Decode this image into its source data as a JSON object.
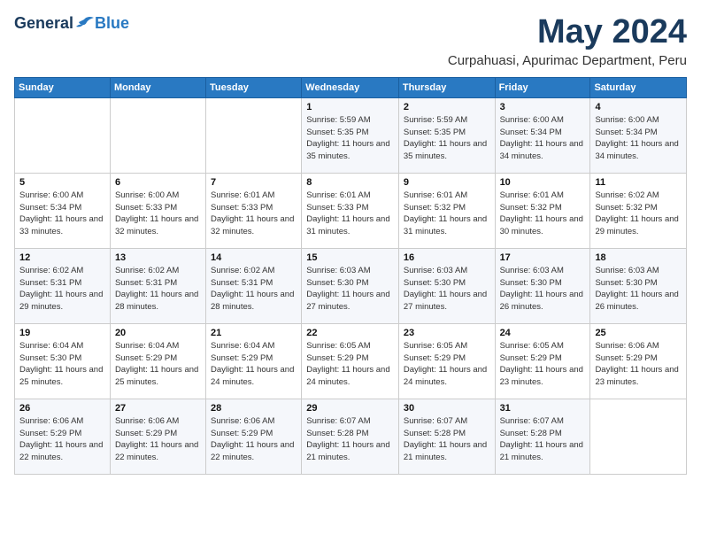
{
  "header": {
    "logo_general": "General",
    "logo_blue": "Blue",
    "month": "May 2024",
    "location": "Curpahuasi, Apurimac Department, Peru"
  },
  "weekdays": [
    "Sunday",
    "Monday",
    "Tuesday",
    "Wednesday",
    "Thursday",
    "Friday",
    "Saturday"
  ],
  "weeks": [
    [
      {
        "day": "",
        "sunrise": "",
        "sunset": "",
        "daylight": ""
      },
      {
        "day": "",
        "sunrise": "",
        "sunset": "",
        "daylight": ""
      },
      {
        "day": "",
        "sunrise": "",
        "sunset": "",
        "daylight": ""
      },
      {
        "day": "1",
        "sunrise": "Sunrise: 5:59 AM",
        "sunset": "Sunset: 5:35 PM",
        "daylight": "Daylight: 11 hours and 35 minutes."
      },
      {
        "day": "2",
        "sunrise": "Sunrise: 5:59 AM",
        "sunset": "Sunset: 5:35 PM",
        "daylight": "Daylight: 11 hours and 35 minutes."
      },
      {
        "day": "3",
        "sunrise": "Sunrise: 6:00 AM",
        "sunset": "Sunset: 5:34 PM",
        "daylight": "Daylight: 11 hours and 34 minutes."
      },
      {
        "day": "4",
        "sunrise": "Sunrise: 6:00 AM",
        "sunset": "Sunset: 5:34 PM",
        "daylight": "Daylight: 11 hours and 34 minutes."
      }
    ],
    [
      {
        "day": "5",
        "sunrise": "Sunrise: 6:00 AM",
        "sunset": "Sunset: 5:34 PM",
        "daylight": "Daylight: 11 hours and 33 minutes."
      },
      {
        "day": "6",
        "sunrise": "Sunrise: 6:00 AM",
        "sunset": "Sunset: 5:33 PM",
        "daylight": "Daylight: 11 hours and 32 minutes."
      },
      {
        "day": "7",
        "sunrise": "Sunrise: 6:01 AM",
        "sunset": "Sunset: 5:33 PM",
        "daylight": "Daylight: 11 hours and 32 minutes."
      },
      {
        "day": "8",
        "sunrise": "Sunrise: 6:01 AM",
        "sunset": "Sunset: 5:33 PM",
        "daylight": "Daylight: 11 hours and 31 minutes."
      },
      {
        "day": "9",
        "sunrise": "Sunrise: 6:01 AM",
        "sunset": "Sunset: 5:32 PM",
        "daylight": "Daylight: 11 hours and 31 minutes."
      },
      {
        "day": "10",
        "sunrise": "Sunrise: 6:01 AM",
        "sunset": "Sunset: 5:32 PM",
        "daylight": "Daylight: 11 hours and 30 minutes."
      },
      {
        "day": "11",
        "sunrise": "Sunrise: 6:02 AM",
        "sunset": "Sunset: 5:32 PM",
        "daylight": "Daylight: 11 hours and 29 minutes."
      }
    ],
    [
      {
        "day": "12",
        "sunrise": "Sunrise: 6:02 AM",
        "sunset": "Sunset: 5:31 PM",
        "daylight": "Daylight: 11 hours and 29 minutes."
      },
      {
        "day": "13",
        "sunrise": "Sunrise: 6:02 AM",
        "sunset": "Sunset: 5:31 PM",
        "daylight": "Daylight: 11 hours and 28 minutes."
      },
      {
        "day": "14",
        "sunrise": "Sunrise: 6:02 AM",
        "sunset": "Sunset: 5:31 PM",
        "daylight": "Daylight: 11 hours and 28 minutes."
      },
      {
        "day": "15",
        "sunrise": "Sunrise: 6:03 AM",
        "sunset": "Sunset: 5:30 PM",
        "daylight": "Daylight: 11 hours and 27 minutes."
      },
      {
        "day": "16",
        "sunrise": "Sunrise: 6:03 AM",
        "sunset": "Sunset: 5:30 PM",
        "daylight": "Daylight: 11 hours and 27 minutes."
      },
      {
        "day": "17",
        "sunrise": "Sunrise: 6:03 AM",
        "sunset": "Sunset: 5:30 PM",
        "daylight": "Daylight: 11 hours and 26 minutes."
      },
      {
        "day": "18",
        "sunrise": "Sunrise: 6:03 AM",
        "sunset": "Sunset: 5:30 PM",
        "daylight": "Daylight: 11 hours and 26 minutes."
      }
    ],
    [
      {
        "day": "19",
        "sunrise": "Sunrise: 6:04 AM",
        "sunset": "Sunset: 5:30 PM",
        "daylight": "Daylight: 11 hours and 25 minutes."
      },
      {
        "day": "20",
        "sunrise": "Sunrise: 6:04 AM",
        "sunset": "Sunset: 5:29 PM",
        "daylight": "Daylight: 11 hours and 25 minutes."
      },
      {
        "day": "21",
        "sunrise": "Sunrise: 6:04 AM",
        "sunset": "Sunset: 5:29 PM",
        "daylight": "Daylight: 11 hours and 24 minutes."
      },
      {
        "day": "22",
        "sunrise": "Sunrise: 6:05 AM",
        "sunset": "Sunset: 5:29 PM",
        "daylight": "Daylight: 11 hours and 24 minutes."
      },
      {
        "day": "23",
        "sunrise": "Sunrise: 6:05 AM",
        "sunset": "Sunset: 5:29 PM",
        "daylight": "Daylight: 11 hours and 24 minutes."
      },
      {
        "day": "24",
        "sunrise": "Sunrise: 6:05 AM",
        "sunset": "Sunset: 5:29 PM",
        "daylight": "Daylight: 11 hours and 23 minutes."
      },
      {
        "day": "25",
        "sunrise": "Sunrise: 6:06 AM",
        "sunset": "Sunset: 5:29 PM",
        "daylight": "Daylight: 11 hours and 23 minutes."
      }
    ],
    [
      {
        "day": "26",
        "sunrise": "Sunrise: 6:06 AM",
        "sunset": "Sunset: 5:29 PM",
        "daylight": "Daylight: 11 hours and 22 minutes."
      },
      {
        "day": "27",
        "sunrise": "Sunrise: 6:06 AM",
        "sunset": "Sunset: 5:29 PM",
        "daylight": "Daylight: 11 hours and 22 minutes."
      },
      {
        "day": "28",
        "sunrise": "Sunrise: 6:06 AM",
        "sunset": "Sunset: 5:29 PM",
        "daylight": "Daylight: 11 hours and 22 minutes."
      },
      {
        "day": "29",
        "sunrise": "Sunrise: 6:07 AM",
        "sunset": "Sunset: 5:28 PM",
        "daylight": "Daylight: 11 hours and 21 minutes."
      },
      {
        "day": "30",
        "sunrise": "Sunrise: 6:07 AM",
        "sunset": "Sunset: 5:28 PM",
        "daylight": "Daylight: 11 hours and 21 minutes."
      },
      {
        "day": "31",
        "sunrise": "Sunrise: 6:07 AM",
        "sunset": "Sunset: 5:28 PM",
        "daylight": "Daylight: 11 hours and 21 minutes."
      },
      {
        "day": "",
        "sunrise": "",
        "sunset": "",
        "daylight": ""
      }
    ]
  ]
}
